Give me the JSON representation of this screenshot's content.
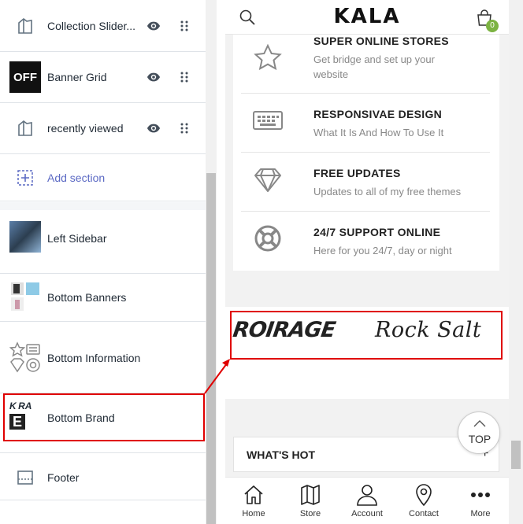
{
  "sidebar": {
    "sections": [
      {
        "label": "Collection Slider...",
        "icon": "section-icon",
        "has_eye": true
      },
      {
        "label": "Banner Grid",
        "icon": "banner-grid-thumbnail",
        "has_eye": true
      },
      {
        "label": "recently viewed",
        "icon": "section-icon",
        "has_eye": true
      }
    ],
    "add_section": "Add section",
    "groups": [
      {
        "label": "Left Sidebar",
        "icon": "left-sidebar-thumbnail"
      },
      {
        "label": "Bottom Banners",
        "icon": "bottom-banners-thumbnail"
      },
      {
        "label": "Bottom Information",
        "icon": "bottom-information-thumbnail"
      },
      {
        "label": "Bottom Brand",
        "icon": "bottom-brand-thumbnail",
        "selected": true
      },
      {
        "label": "Footer",
        "icon": "footer-icon"
      }
    ],
    "thumb_text": {
      "banner": "OFF",
      "brand_top": "K",
      "brand_top2": "RA",
      "brand_bottom": "E"
    }
  },
  "preview": {
    "logo": "KALA",
    "cart_count": "0",
    "features": [
      {
        "title": "SUPER ONLINE STORES",
        "subtitle": "Get bridge and set up your",
        "subtitle2": "website",
        "icon": "star-icon"
      },
      {
        "title": "RESPONSIVAE DESIGN",
        "subtitle": "What It Is And How To Use It",
        "icon": "keyboard-icon"
      },
      {
        "title": "FREE UPDATES",
        "subtitle": "Updates to all of my free themes",
        "icon": "diamond-icon"
      },
      {
        "title": "24/7 SUPPORT ONLINE",
        "subtitle": "Here for you 24/7, day or night",
        "icon": "lifebuoy-icon"
      }
    ],
    "brands": [
      "ROIRAGE",
      "Rock Salt"
    ],
    "whats_hot": "WHAT'S HOT",
    "whats_hot_toggle": "+",
    "top_button": "TOP",
    "nav": [
      {
        "label": "Home",
        "icon": "home-icon"
      },
      {
        "label": "Store",
        "icon": "map-icon"
      },
      {
        "label": "Account",
        "icon": "user-icon"
      },
      {
        "label": "Contact",
        "icon": "location-pin-icon"
      },
      {
        "label": "More",
        "icon": "more-dots-icon"
      }
    ]
  },
  "colors": {
    "highlight": "#e00000",
    "accent": "#5c6ac4",
    "badge": "#7cb342"
  }
}
